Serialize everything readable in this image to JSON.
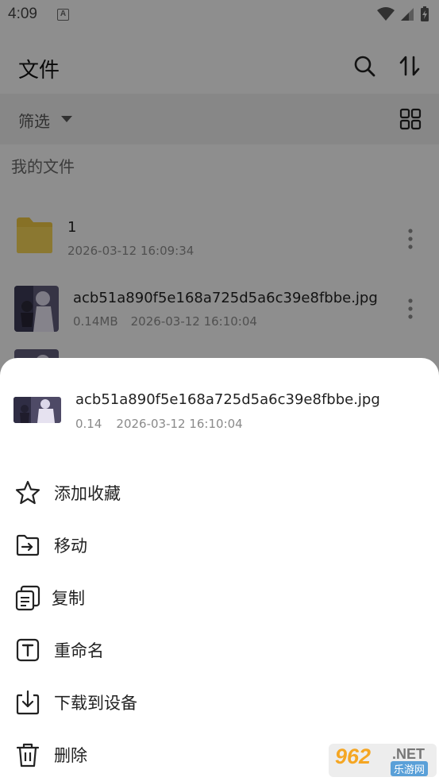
{
  "status_bar": {
    "time": "4:09",
    "notification_icon": "A"
  },
  "appbar": {
    "title": "文件",
    "icons": [
      "search-icon",
      "sort-icon"
    ]
  },
  "filter_bar": {
    "label": "筛选",
    "icons": [
      "dropdown-caret-icon",
      "grid-view-icon"
    ]
  },
  "section_title": "我的文件",
  "files": [
    {
      "type": "folder",
      "name": "1",
      "date": "2026-03-12 16:09:34"
    },
    {
      "type": "image",
      "name": "acb51a890f5e168a725d5a6c39e8fbbe.jpg",
      "size": "0.14MB",
      "date": "2026-03-12 16:10:04"
    }
  ],
  "sheet": {
    "file_name": "acb51a890f5e168a725d5a6c39e8fbbe.jpg",
    "file_size": "0.14",
    "file_date": "2026-03-12 16:10:04",
    "actions": [
      {
        "label": "添加收藏",
        "icon": "star-icon"
      },
      {
        "label": "移动",
        "icon": "move-folder-icon"
      },
      {
        "label": "复制",
        "icon": "copy-icon"
      },
      {
        "label": "重命名",
        "icon": "rename-icon"
      },
      {
        "label": "下载到设备",
        "icon": "download-icon"
      },
      {
        "label": "删除",
        "icon": "trash-icon"
      }
    ]
  },
  "watermark": {
    "number": "962",
    "suffix": ".NET",
    "caption": "乐游网"
  },
  "colors": {
    "folder": "#e8c343",
    "scrim": "#000000",
    "sheet_bg": "#ffffff"
  }
}
